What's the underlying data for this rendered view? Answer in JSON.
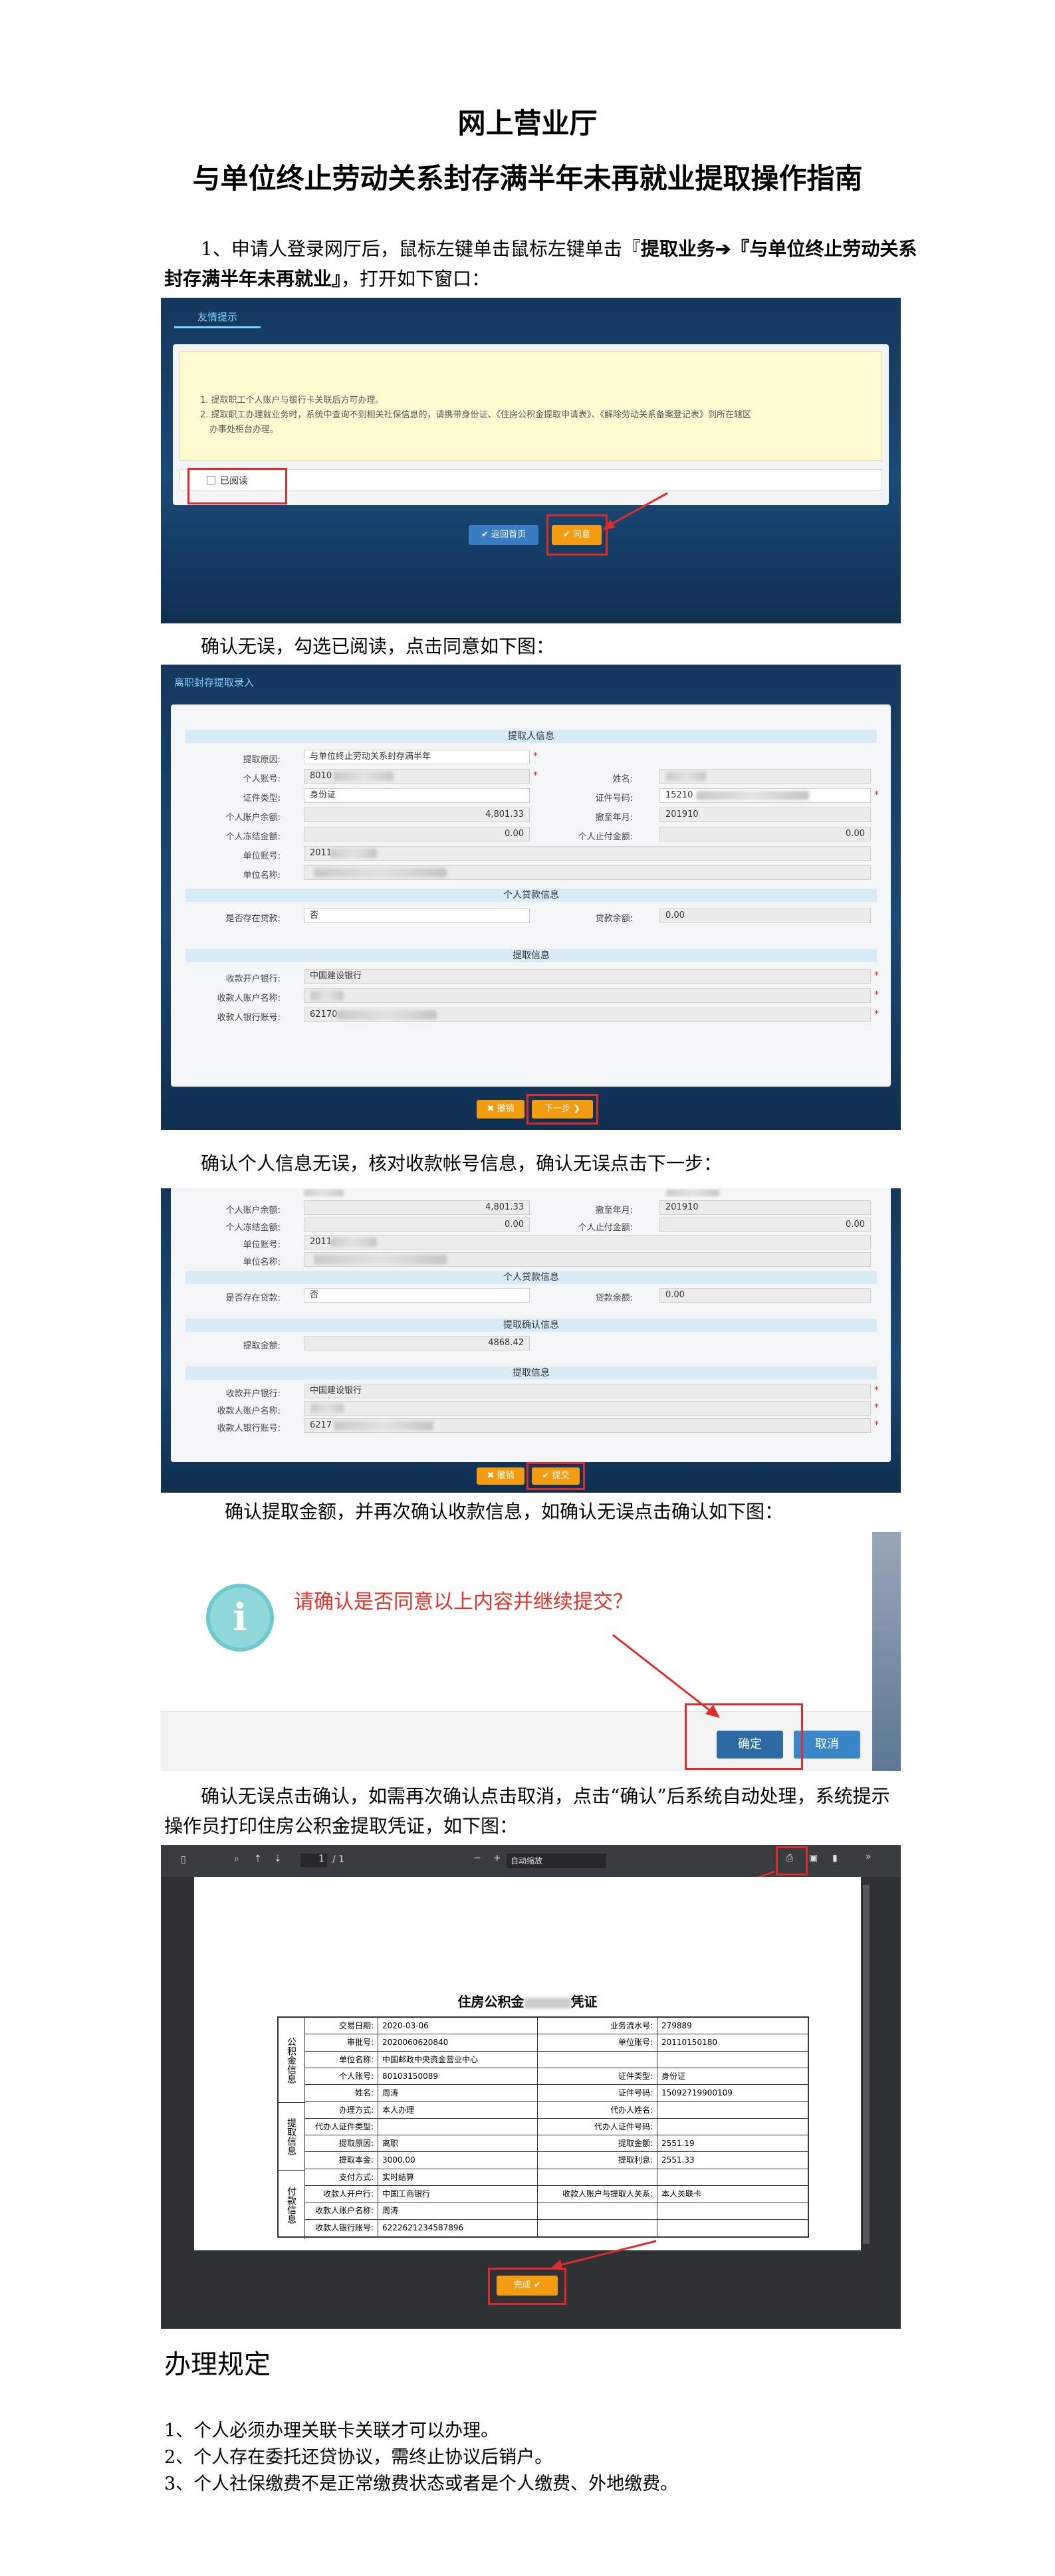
{
  "doc": {
    "title1": "网上营业厅",
    "title2": "与单位终止劳动关系封存满半年未再就业提取操作指南",
    "step1_pre": "1、申请人登录网厅后，鼠标左键单击鼠标左键单击『",
    "step1_bold1": "提取业务",
    "step1_arrow": "➔",
    "step1_bold2": "『与单位终止劳动关",
    "step1_bold3": "系封存满半年未再就业』",
    "step1_post": "，打开如下窗口：",
    "step2": "确认无误，勾选已阅读，点击同意如下图：",
    "step3": "确认个人信息无误，核对收款帐号信息，确认无误点击下一步：",
    "step4": "确认提取金额，并再次确认收款信息，如确认无误点击确认如下图：",
    "step5_l1": "确认无误点击确认，如需再次确认点击取消，点击“确认”后系统自动处理，系统提示",
    "step5_l2": "操作员打印住房公积金提取凭证，如下图：",
    "rules_title": "办理规定",
    "rules": [
      "1、个人必须办理关联卡关联才可以办理。",
      "2、个人存在委托还贷协议，需终止协议后销户。",
      "3、个人社保缴费不是正常缴费状态或者是个人缴费、外地缴费。"
    ]
  },
  "shot1": {
    "tab": "友情提示",
    "note1": "1. 提取职工个人账户与银行卡关联后方可办理。",
    "note2": "2. 提取职工办理就业务时，系统中查询不到相关社保信息的，请携带身份证、《住房公积金提取申请表》、《解除劳动关系备案登记表》到所在辖区",
    "note3": "办事处柜台办理。",
    "checkbox_label": "已阅读",
    "back_btn": "返回首页",
    "agree_btn": "同意"
  },
  "shot2": {
    "tab": "离职封存提取录入",
    "sec1": "提取人信息",
    "reason_lbl": "提取原因:",
    "reason_val": "与单位终止劳动关系封存满半年",
    "acct_lbl": "个人账号:",
    "acct_val": "8010",
    "name_lbl": "姓名:",
    "idtype_lbl": "证件类型:",
    "idtype_val": "身份证",
    "idno_lbl": "证件号码:",
    "idno_val": "15210",
    "bal_lbl": "个人账户余额:",
    "bal_val": "4,801.33",
    "sealym_lbl": "撤至年月:",
    "sealym_val": "201910",
    "frozen_lbl": "个人冻结金额:",
    "frozen_val": "0.00",
    "stoppay_lbl": "个人止付金额:",
    "stoppay_val": "0.00",
    "unitacct_lbl": "单位账号:",
    "unitacct_val": "2011",
    "unitname_lbl": "单位名称:",
    "sec2": "个人贷款信息",
    "loan_lbl": "是否存在贷款:",
    "loan_val": "否",
    "loanbal_lbl": "贷款余额:",
    "loanbal_val": "0.00",
    "sec3": "提取信息",
    "bank_lbl": "收款开户银行:",
    "bank_val": "中国建设银行",
    "payee_lbl": "收款人账户名称:",
    "payacct_lbl": "收款人银行账号:",
    "payacct_val": "62170",
    "cancel_btn": "撤销",
    "next_btn": "下一步"
  },
  "shot3": {
    "bal_lbl": "个人账户余额:",
    "bal_val": "4,801.33",
    "sealym_lbl": "撤至年月:",
    "sealym_val": "201910",
    "frozen_lbl": "个人冻结金额:",
    "frozen_val": "0.00",
    "stoppay_lbl": "个人止付金额:",
    "stoppay_val": "0.00",
    "unitacct_lbl": "单位账号:",
    "unitacct_val": "2011",
    "unitname_lbl": "单位名称:",
    "sec2": "个人贷款信息",
    "loan_lbl": "是否存在贷款:",
    "loan_val": "否",
    "loanbal_lbl": "贷款余额:",
    "loanbal_val": "0.00",
    "sec_confirm": "提取确认信息",
    "amount_lbl": "提取金额:",
    "amount_val": "4868.42",
    "sec3": "提取信息",
    "bank_lbl": "收款开户银行:",
    "bank_val": "中国建设银行",
    "payee_lbl": "收款人账户名称:",
    "payacct_lbl": "收款人银行账号:",
    "payacct_val": "6217",
    "cancel_btn": "撤销",
    "submit_btn": "提交"
  },
  "shot4": {
    "message": "请确认是否同意以上内容并继续提交？",
    "info_glyph": "i",
    "ok_btn": "确定",
    "cancel_btn": "取消"
  },
  "shot5": {
    "page_input": "1",
    "page_total": "/ 1",
    "zoom": "自动缩放",
    "annotation": "打印",
    "voucher_title": "住房公积金",
    "voucher_title2": "凭证",
    "side_a": "公积金信息",
    "side_b": "提取信息",
    "side_c": "付款信息",
    "rows": [
      [
        "交易日期:",
        "2020-03-06",
        "业务流水号:",
        "279889"
      ],
      [
        "审批号:",
        "2020060620840",
        "单位账号:",
        "20110150180"
      ],
      [
        "单位名称:",
        "中国邮政中央资金营业中心",
        "",
        ""
      ],
      [
        "个人账号:",
        "80103150089",
        "证件类型:",
        "身份证"
      ],
      [
        "姓名:",
        "周涛",
        "证件号码:",
        "15092719900109"
      ],
      [
        "办理方式:",
        "本人办理",
        "代办人姓名:",
        ""
      ],
      [
        "代办人证件类型:",
        "",
        "代办人证件号码:",
        ""
      ],
      [
        "提取原因:",
        "离职",
        "提取金额:",
        "2551.19"
      ],
      [
        "提取本金:",
        "3000.00",
        "提取利息:",
        "2551.33"
      ],
      [
        "支付方式:",
        "实时结算",
        "",
        ""
      ],
      [
        "收款人开户行:",
        "中国工商银行",
        "收款人账户与提取人关系:",
        "本人关联卡"
      ],
      [
        "收款人账户名称:",
        "周涛",
        "",
        ""
      ],
      [
        "收款人银行账号:",
        "6222621234587896",
        "",
        ""
      ]
    ],
    "done_btn": "完成"
  },
  "colors": {
    "dark_bg": "#1a4a78",
    "accent_blue": "#3a7cc1",
    "accent_orange": "#f39c12",
    "highlight_red": "#e02b2b",
    "section_blue": "#d8ecf8"
  }
}
